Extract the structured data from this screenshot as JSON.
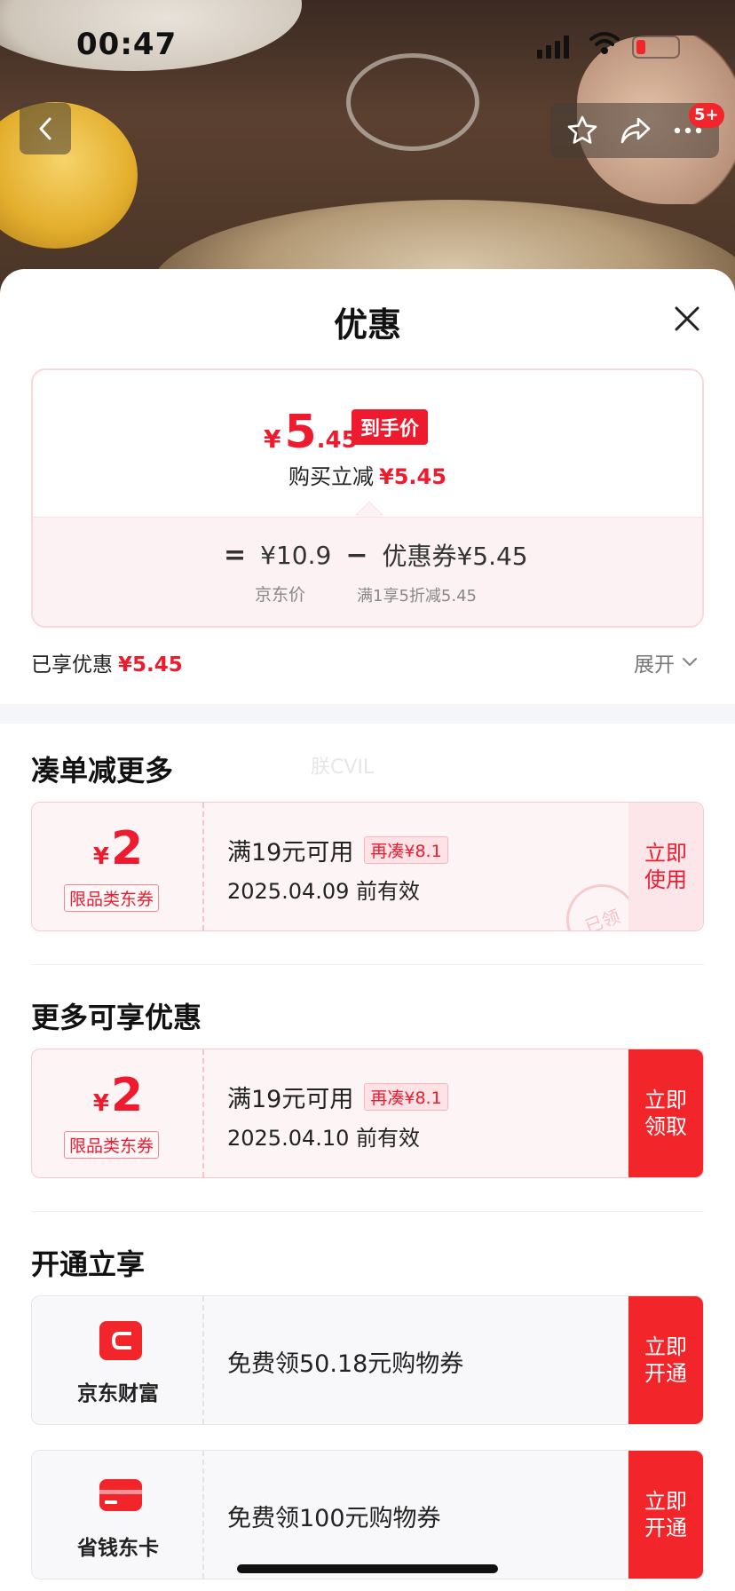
{
  "status_bar": {
    "time": "00:47"
  },
  "nav": {
    "more_badge": "5+"
  },
  "sheet": {
    "title": "优惠",
    "price_card": {
      "final_yen": "¥",
      "final_int": "5",
      "final_dec": ".45",
      "final_tag": "到手价",
      "instant_label": "购买立减",
      "instant_value": "¥5.45",
      "eq": "=",
      "jd_price": "¥10.9",
      "minus": "−",
      "coupon_formula": "优惠券¥5.45",
      "jd_price_label": "京东价",
      "coupon_detail": "满1享5折减5.45"
    },
    "enjoyed_label": "已享优惠",
    "enjoyed_value": "¥5.45",
    "expand_label": "展开",
    "watermark": "朕CVIL",
    "section_combine": {
      "title": "凑单减更多",
      "coupon": {
        "yen": "¥",
        "amount": "2",
        "category": "限品类东券",
        "condition": "满19元可用",
        "extra_tag": "再凑¥8.1",
        "validity": "2025.04.09 前有效",
        "action": "立即使用",
        "stamp": "已领"
      }
    },
    "section_more": {
      "title": "更多可享优惠",
      "coupon": {
        "yen": "¥",
        "amount": "2",
        "category": "限品类东券",
        "condition": "满19元可用",
        "extra_tag": "再凑¥8.1",
        "validity": "2025.04.10 前有效",
        "action": "立即领取"
      }
    },
    "section_open": {
      "title": "开通立享",
      "cards": [
        {
          "brand": "京东财富",
          "desc": "免费领50.18元购物券",
          "action": "立即开通"
        },
        {
          "brand": "省钱东卡",
          "desc": "免费领100元购物券",
          "action": "立即开通"
        }
      ]
    }
  },
  "colors": {
    "accent": "#f2262a",
    "price_red": "#ee1b2e",
    "coupon_bg": "#fdf4f5"
  }
}
